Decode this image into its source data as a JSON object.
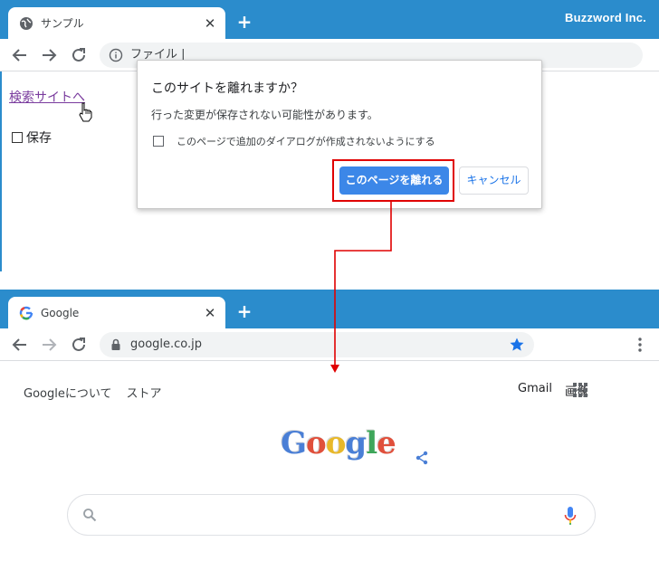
{
  "top_window": {
    "tab_title": "サンプル",
    "close_glyph": "✕",
    "new_tab_glyph": "+",
    "brand": "Buzzword Inc.",
    "omnibox_text": "ファイル |",
    "page": {
      "link_label": "検索サイトへ",
      "checkbox_label": "保存"
    },
    "dialog": {
      "title": "このサイトを離れますか？",
      "message": "行った変更が保存されない可能性があります。",
      "checkbox_label": "このページで追加のダイアログが作成されないようにする",
      "leave_button": "このページを離れる",
      "cancel_button": "キャンセル"
    }
  },
  "bottom_window": {
    "tab_title": "Google",
    "close_glyph": "✕",
    "new_tab_glyph": "+",
    "omnibox_text": "google.co.jp",
    "header_left": [
      "Googleについて",
      "ストア"
    ],
    "header_right": [
      "Gmail",
      "画像"
    ],
    "logo_letters": [
      "G",
      "o",
      "o",
      "g",
      "l",
      "e"
    ]
  },
  "colors": {
    "tabstrip": "#2b8ccc",
    "accent_button": "#3c87e8",
    "highlight": "#e00000",
    "link_visited": "#7a3c9e"
  },
  "icons": [
    "globe-icon",
    "back-arrow-icon",
    "forward-arrow-icon",
    "reload-icon",
    "info-icon",
    "hand-cursor-icon",
    "google-g-icon",
    "lock-icon",
    "star-icon",
    "menu-dots-icon",
    "apps-grid-icon",
    "share-icon",
    "search-icon",
    "mic-icon"
  ]
}
